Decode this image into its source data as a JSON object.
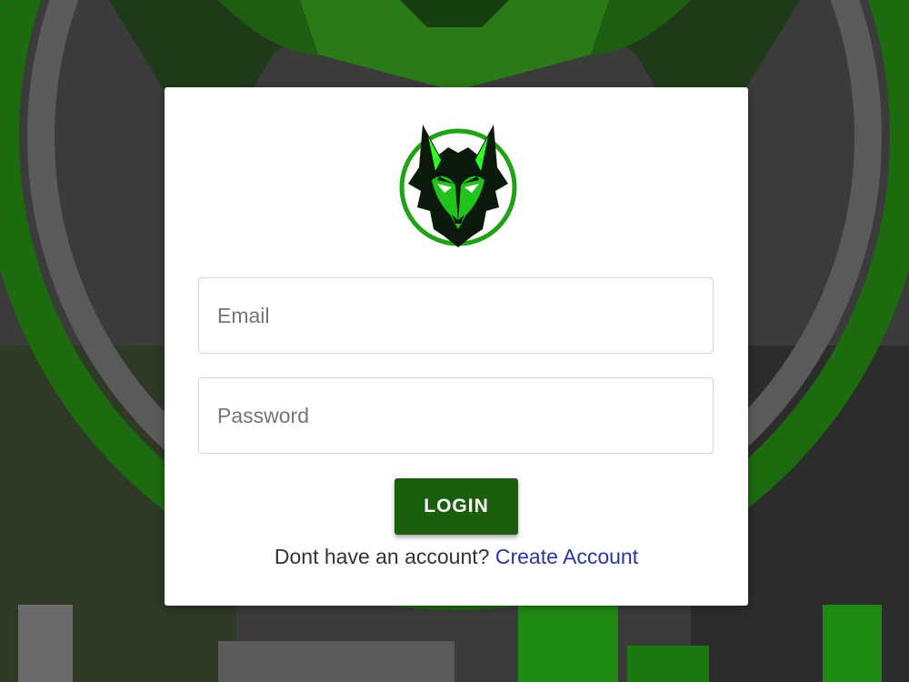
{
  "background": {
    "dim_color": "#3c3c3c",
    "accent_color": "#1f7a12"
  },
  "logo": {
    "icon": "wolf-head-icon",
    "ring_color": "#1ea412",
    "glow_color": "#2bff22"
  },
  "login_form": {
    "email_placeholder": "Email",
    "password_placeholder": "Password",
    "login_label": "LOGIN",
    "button_color": "#1a5e0e",
    "signup_prompt": "Dont have an account?",
    "signup_link": "Create Account",
    "link_color": "#2a35a8"
  }
}
